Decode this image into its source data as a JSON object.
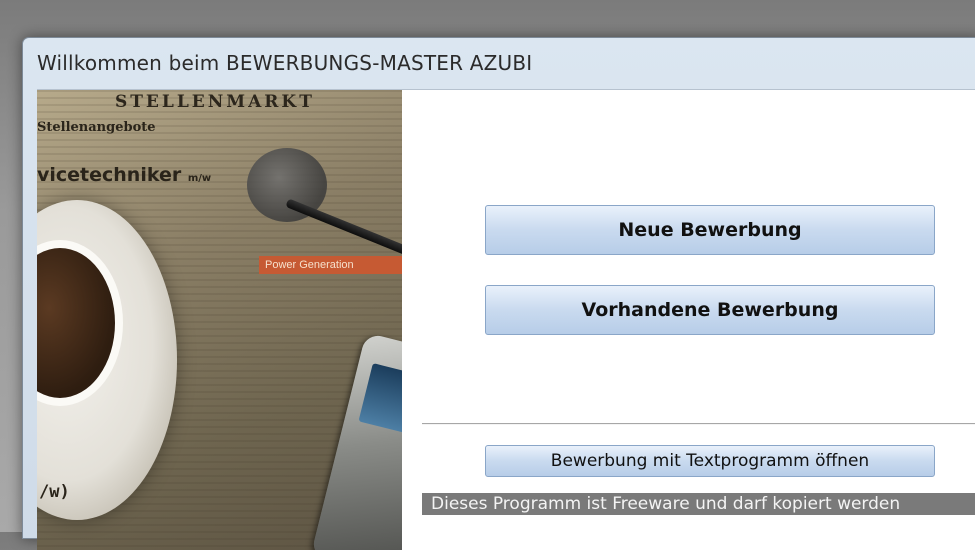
{
  "window": {
    "title": "Willkommen beim BEWERBUNGS-MASTER AZUBI"
  },
  "photo": {
    "heading": "STELLENMARKT",
    "subheading": "Stellenangebote",
    "job": "vicetechniker",
    "job_suffix": "m/w",
    "banner": "Power Generation",
    "bottom": "/w)"
  },
  "actions": {
    "new_application": "Neue Bewerbung",
    "existing_application": "Vorhandene Bewerbung",
    "open_with_text_program": "Bewerbung mit Textprogramm öffnen"
  },
  "status": {
    "text": "Dieses Programm ist Freeware und darf kopiert werden"
  }
}
